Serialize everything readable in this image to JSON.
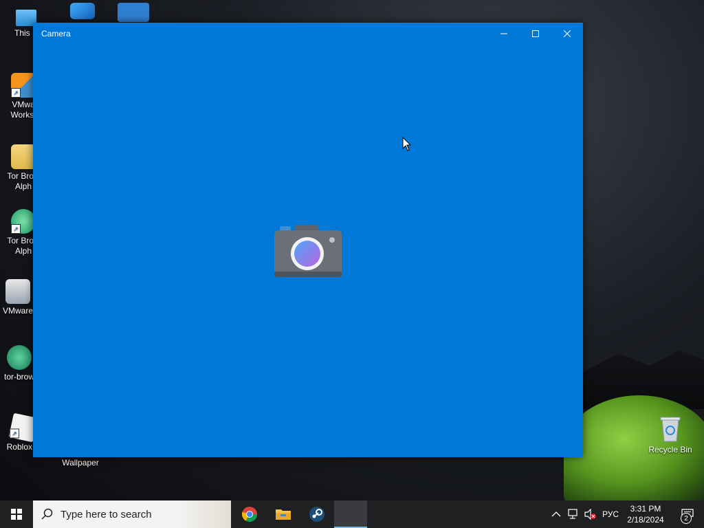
{
  "desktop": {
    "icons": [
      {
        "label": "This P",
        "icon": "computer-icon"
      },
      {
        "label": "VMwa\nWorkst",
        "icon": "vmware-workstation-icon"
      },
      {
        "label": "Tor Brow\nAlph",
        "icon": "tor-browser-folder-icon"
      },
      {
        "label": "Tor Brow\nAlph",
        "icon": "tor-browser-icon"
      },
      {
        "label": "VMware",
        "icon": "vmware-installer-icon"
      },
      {
        "label": "tor-brow",
        "icon": "tor-browser-archive-icon"
      },
      {
        "label": "Roblox P",
        "icon": "roblox-icon"
      },
      {
        "label": "Wallpaper",
        "icon": "wallpaper-icon"
      },
      {
        "label": "Recycle Bin",
        "icon": "recycle-bin-icon"
      }
    ]
  },
  "window": {
    "title": "Camera",
    "accent_color": "#0078d7"
  },
  "taskbar": {
    "search_placeholder": "Type here to search",
    "apps": [
      "chrome-icon",
      "file-explorer-icon",
      "steam-icon",
      "camera-app-icon"
    ],
    "tray": {
      "language": "РУС",
      "time": "3:31 PM",
      "date": "2/18/2024",
      "notification_count": "2"
    }
  }
}
